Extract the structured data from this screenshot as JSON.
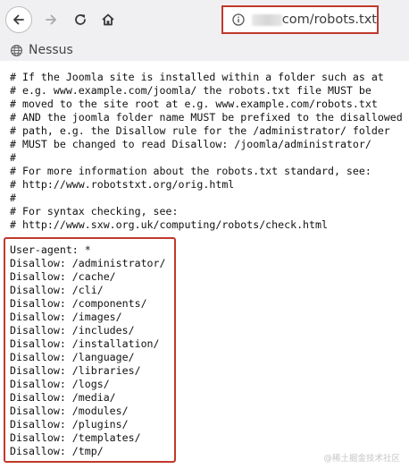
{
  "toolbar": {
    "url_text": "com/robots.txt"
  },
  "bookmarks": {
    "items": [
      {
        "label": "Nessus"
      }
    ]
  },
  "document": {
    "comment_lines": [
      "# If the Joomla site is installed within a folder such as at",
      "# e.g. www.example.com/joomla/ the robots.txt file MUST be",
      "# moved to the site root at e.g. www.example.com/robots.txt",
      "# AND the joomla folder name MUST be prefixed to the disallowed",
      "# path, e.g. the Disallow rule for the /administrator/ folder",
      "# MUST be changed to read Disallow: /joomla/administrator/",
      "#",
      "# For more information about the robots.txt standard, see:",
      "# http://www.robotstxt.org/orig.html",
      "#",
      "# For syntax checking, see:",
      "# http://www.sxw.org.uk/computing/robots/check.html"
    ],
    "rule_lines": [
      "User-agent: *",
      "Disallow: /administrator/",
      "Disallow: /cache/",
      "Disallow: /cli/",
      "Disallow: /components/",
      "Disallow: /images/",
      "Disallow: /includes/",
      "Disallow: /installation/",
      "Disallow: /language/",
      "Disallow: /libraries/",
      "Disallow: /logs/",
      "Disallow: /media/",
      "Disallow: /modules/",
      "Disallow: /plugins/",
      "Disallow: /templates/",
      "Disallow: /tmp/"
    ]
  },
  "watermark": "@稀土掘金技术社区",
  "colors": {
    "highlight_border": "#c0392b",
    "toolbar_bg": "#f0f0f2",
    "text": "#111111"
  }
}
